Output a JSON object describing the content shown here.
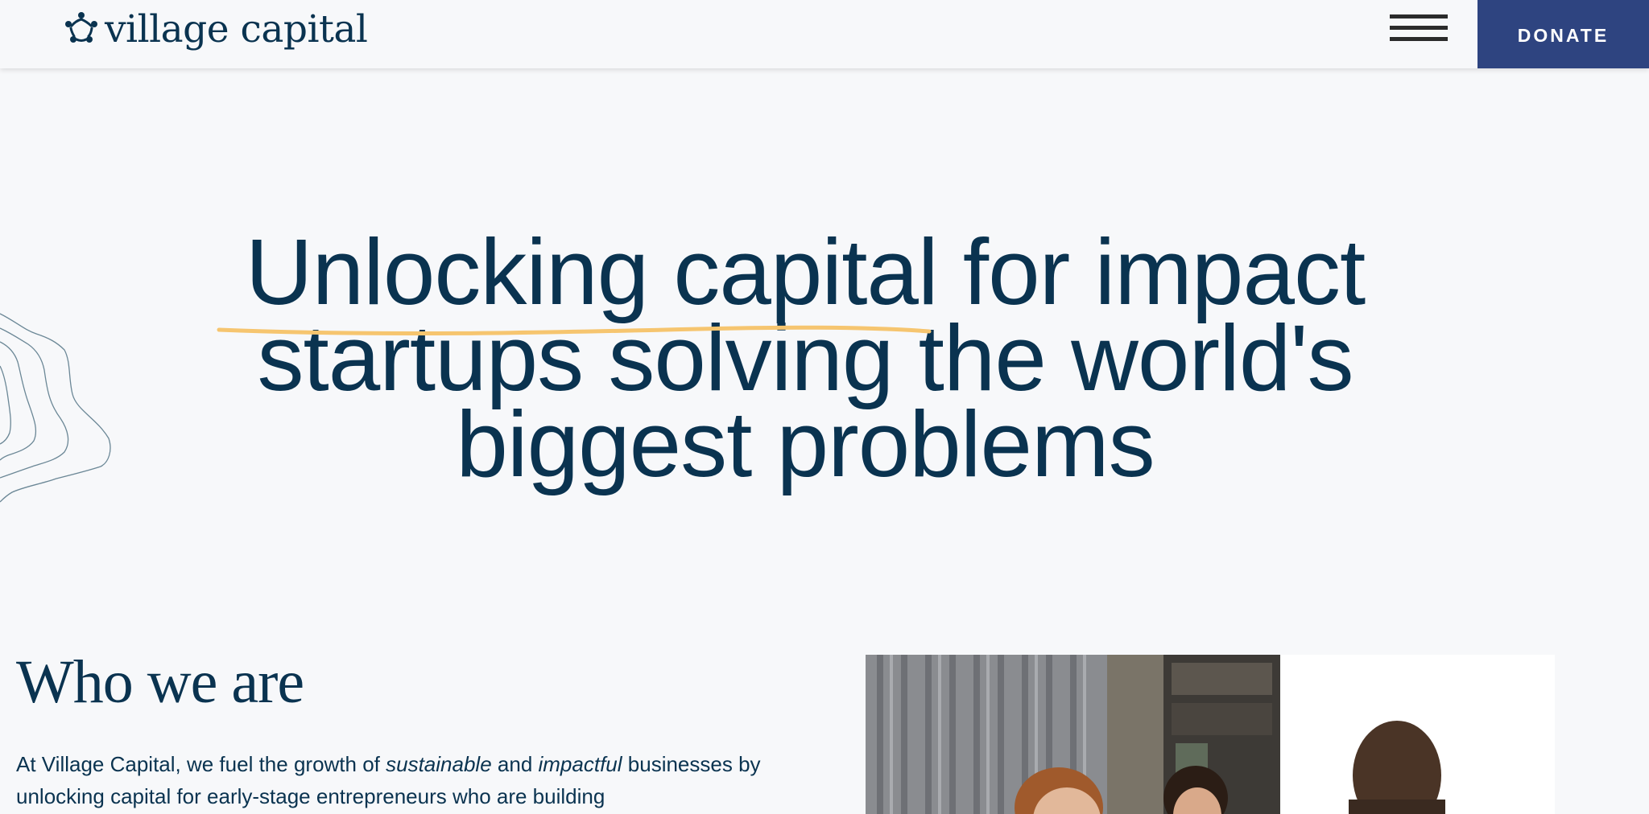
{
  "header": {
    "logo_text": "village capital",
    "menu_icon": "hamburger-menu-icon",
    "donate_label": "DONATE"
  },
  "hero": {
    "title": "Unlocking capital for impact startups solving the world's biggest problems"
  },
  "who": {
    "title": "Who we are",
    "text_part1": "At Village Capital, we fuel the growth of ",
    "text_em1": "sustainable",
    "text_part2": " and ",
    "text_em2": "impactful",
    "text_part3": " businesses by unlocking capital for early-stage entrepreneurs who are building"
  },
  "colors": {
    "navy": "#0a3350",
    "donate_bg": "#2e4480",
    "underline": "#f6c56f",
    "background": "#f7f8fa"
  }
}
